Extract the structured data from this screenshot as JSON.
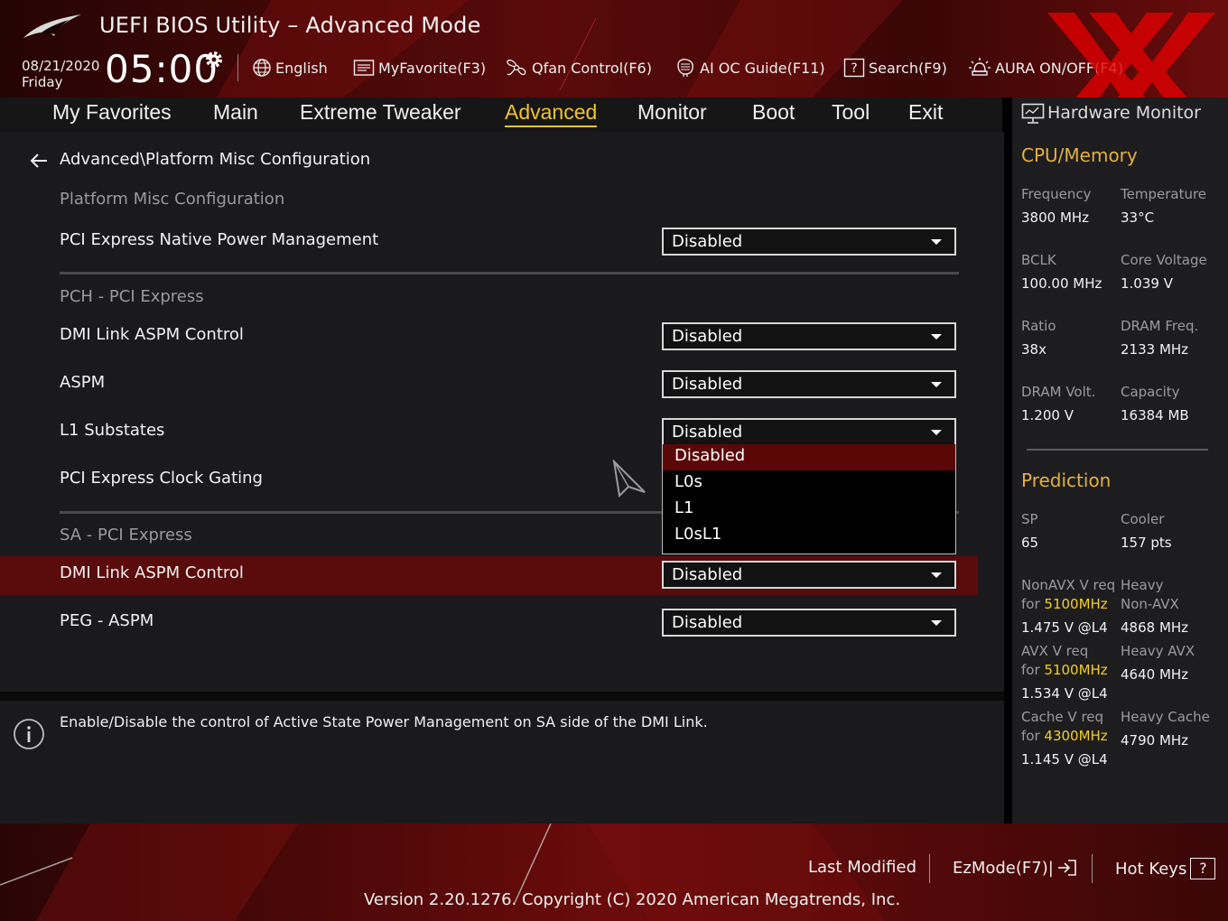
{
  "header": {
    "title": "UEFI BIOS Utility – Advanced Mode",
    "date": "08/21/2020",
    "day": "Friday",
    "time": "05:00",
    "toolbar": [
      {
        "label": "English",
        "icon": "globe-icon"
      },
      {
        "label": "MyFavorite(F3)",
        "icon": "favorite-list-icon"
      },
      {
        "label": "Qfan Control(F6)",
        "icon": "fan-icon"
      },
      {
        "label": "AI OC Guide(F11)",
        "icon": "ai-chip-icon"
      },
      {
        "label": "Search(F9)",
        "icon": "search-question-icon"
      },
      {
        "label": "AURA ON/OFF(F4)",
        "icon": "aura-light-icon"
      }
    ]
  },
  "nav": {
    "tabs": [
      "My Favorites",
      "Main",
      "Extreme Tweaker",
      "Advanced",
      "Monitor",
      "Boot",
      "Tool",
      "Exit"
    ],
    "active": "Advanced"
  },
  "main": {
    "breadcrumb": "Advanced\\Platform Misc Configuration",
    "sections": {
      "platform": "Platform Misc Configuration",
      "pch": "PCH - PCI Express",
      "sa": "SA - PCI Express"
    },
    "settings": {
      "pcie_native_pm": {
        "label": "PCI Express Native Power Management",
        "value": "Disabled"
      },
      "pch_dmi_aspm": {
        "label": "DMI Link ASPM Control",
        "value": "Disabled"
      },
      "aspm": {
        "label": "ASPM",
        "value": "Disabled"
      },
      "l1_substates": {
        "label": "L1 Substates",
        "value": "Disabled"
      },
      "pcie_clock_gating": {
        "label": "PCI Express Clock Gating"
      },
      "sa_dmi_aspm": {
        "label": "DMI Link ASPM Control",
        "value": "Disabled"
      },
      "peg_aspm": {
        "label": "PEG - ASPM",
        "value": "Disabled"
      }
    },
    "dropdown_options": [
      "Disabled",
      "L0s",
      "L1",
      "L0sL1"
    ],
    "dropdown_selected": "Disabled"
  },
  "help": {
    "text": "Enable/Disable the control of Active State Power Management on SA side of the DMI Link."
  },
  "hw_monitor": {
    "title": "Hardware Monitor",
    "cpu_section": "CPU/Memory",
    "cpu": {
      "frequency_label": "Frequency",
      "frequency": "3800 MHz",
      "temperature_label": "Temperature",
      "temperature": "33°C",
      "bclk_label": "BCLK",
      "bclk": "100.00 MHz",
      "core_voltage_label": "Core Voltage",
      "core_voltage": "1.039 V",
      "ratio_label": "Ratio",
      "ratio": "38x",
      "dram_freq_label": "DRAM Freq.",
      "dram_freq": "2133 MHz",
      "dram_volt_label": "DRAM Volt.",
      "dram_volt": "1.200 V",
      "capacity_label": "Capacity",
      "capacity": "16384 MB"
    },
    "prediction_section": "Prediction",
    "prediction": {
      "sp_label": "SP",
      "sp": "65",
      "cooler_label": "Cooler",
      "cooler": "157 pts",
      "nonavx_label": "NonAVX V req",
      "nonavx_for": "for",
      "nonavx_freq": "5100MHz",
      "nonavx_value": "1.475 V @L4",
      "heavy_nonavx_label_1": "Heavy",
      "heavy_nonavx_label_2": "Non-AVX",
      "heavy_nonavx": "4868 MHz",
      "avx_label": "AVX V req",
      "avx_for": "for",
      "avx_freq": "5100MHz",
      "avx_value": "1.534 V @L4",
      "heavy_avx_label": "Heavy AVX",
      "heavy_avx": "4640 MHz",
      "cache_label": "Cache V req",
      "cache_for": "for",
      "cache_freq": "4300MHz",
      "cache_value": "1.145 V @L4",
      "heavy_cache_label": "Heavy Cache",
      "heavy_cache": "4790 MHz"
    }
  },
  "footer": {
    "last_modified": "Last Modified",
    "ezmode": "EzMode(F7)|",
    "hotkeys": "Hot Keys",
    "hotkeys_key": "?",
    "version": "Version 2.20.1276. Copyright (C) 2020 American Megatrends, Inc."
  },
  "colors": {
    "accent": "#f2c230",
    "highlight_row": "#5a0b0b",
    "dropdown_selected": "#5c0707",
    "panel": "#1a1a1c",
    "hw_section": "#e3b13d"
  }
}
